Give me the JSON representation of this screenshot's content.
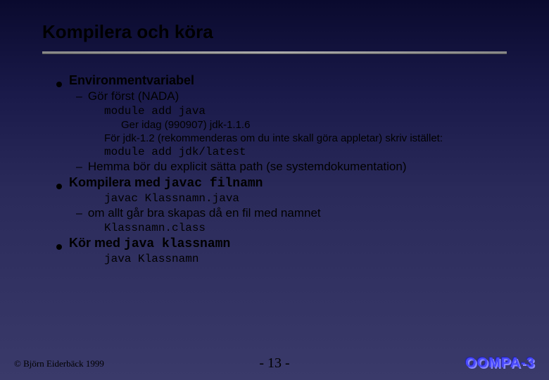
{
  "title": "Kompilera och köra",
  "bullets": [
    {
      "text": "Environmentvariabel",
      "subs": [
        {
          "text": "Gör först (NADA)",
          "code": "module add java",
          "notes": [
            "Ger idag (990907) jdk-1.1.6",
            "För jdk-1.2 (rekommenderas om du inte skall göra appletar) skriv istället:"
          ],
          "code2": "module add jdk/latest"
        },
        {
          "text": "Hemma  bör du explicit sätta path (se systemdokumentation)"
        }
      ]
    },
    {
      "text_prefix": "Kompilera med ",
      "text_code": "javac filnamn",
      "code_ex": "javac Klassnamn.java",
      "subs": [
        {
          "text": "om allt går bra skapas då en fil med namnet",
          "code": "Klassnamn.class"
        }
      ]
    },
    {
      "text_prefix": "Kör med ",
      "text_code": "java klassnamn",
      "code_ex": "java Klassnamn"
    }
  ],
  "footer": {
    "copyright": "© Björn Eiderbäck 1999",
    "page": "- 13 -",
    "logo": "OOMPA-3"
  }
}
